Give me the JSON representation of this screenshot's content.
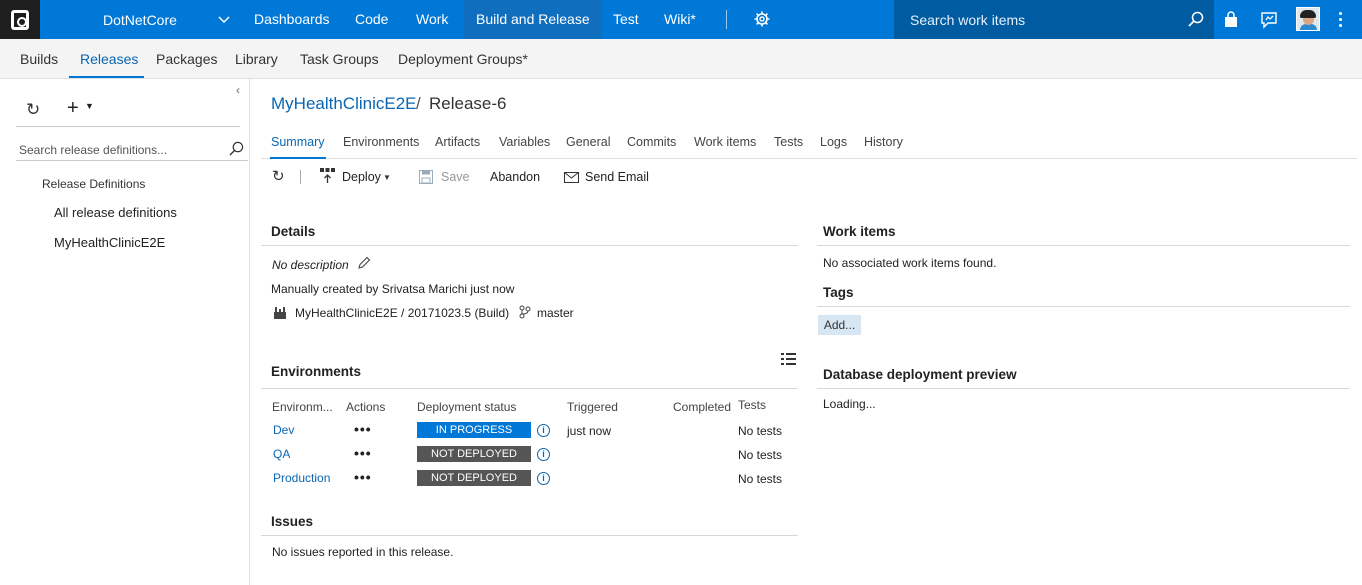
{
  "topbar": {
    "project": "DotNetCore",
    "nav": [
      "Dashboards",
      "Code",
      "Work",
      "Build and Release",
      "Test",
      "Wiki*"
    ],
    "active_nav": "Build and Release",
    "search_placeholder": "Search work items",
    "icons": [
      "vsts-logo-icon",
      "chevron-down-icon",
      "gear-icon",
      "search-icon",
      "marketplace-bag-icon",
      "feedback-icon",
      "user-avatar",
      "more-vertical-icon"
    ]
  },
  "subnav": {
    "tabs": [
      "Builds",
      "Releases",
      "Packages",
      "Library",
      "Task Groups",
      "Deployment Groups*"
    ],
    "active": "Releases"
  },
  "left": {
    "search_placeholder": "Search release definitions...",
    "section_header": "Release Definitions",
    "items": [
      "All release definitions",
      "MyHealthClinicE2E"
    ]
  },
  "breadcrumb": {
    "definition": "MyHealthClinicE2E",
    "separator": "/",
    "release": "Release-6"
  },
  "pivots": [
    "Summary",
    "Environments",
    "Artifacts",
    "Variables",
    "General",
    "Commits",
    "Work items",
    "Tests",
    "Logs",
    "History"
  ],
  "active_pivot": "Summary",
  "toolbar": {
    "deploy": "Deploy",
    "save": "Save",
    "abandon": "Abandon",
    "send_email": "Send Email"
  },
  "details": {
    "title": "Details",
    "description": "No description",
    "created": "Manually created by Srivatsa Marichi just now",
    "artifact": "MyHealthClinicE2E / 20171023.5 (Build)",
    "branch": "master"
  },
  "environments": {
    "title": "Environments",
    "headers": [
      "Environm...",
      "Actions",
      "Deployment status",
      "Triggered",
      "Completed",
      "Tests"
    ],
    "rows": [
      {
        "name": "Dev",
        "actions": "•••",
        "status": "IN PROGRESS",
        "triggered": "just now",
        "completed": "",
        "tests": "No tests"
      },
      {
        "name": "QA",
        "actions": "•••",
        "status": "NOT DEPLOYED",
        "triggered": "",
        "completed": "",
        "tests": "No tests"
      },
      {
        "name": "Production",
        "actions": "•••",
        "status": "NOT DEPLOYED",
        "triggered": "",
        "completed": "",
        "tests": "No tests"
      }
    ],
    "status_colors": {
      "in_progress": "#0078d7",
      "not_deployed": "#555555"
    }
  },
  "issues": {
    "title": "Issues",
    "text": "No issues reported in this release."
  },
  "work_items": {
    "title": "Work items",
    "text": "No associated work items found."
  },
  "tags": {
    "title": "Tags",
    "add": "Add..."
  },
  "db_preview": {
    "title": "Database deployment preview",
    "text": "Loading..."
  },
  "colors": {
    "accent": "#0078d7",
    "topbar": "#0078d7",
    "link": "#0a66b2"
  }
}
